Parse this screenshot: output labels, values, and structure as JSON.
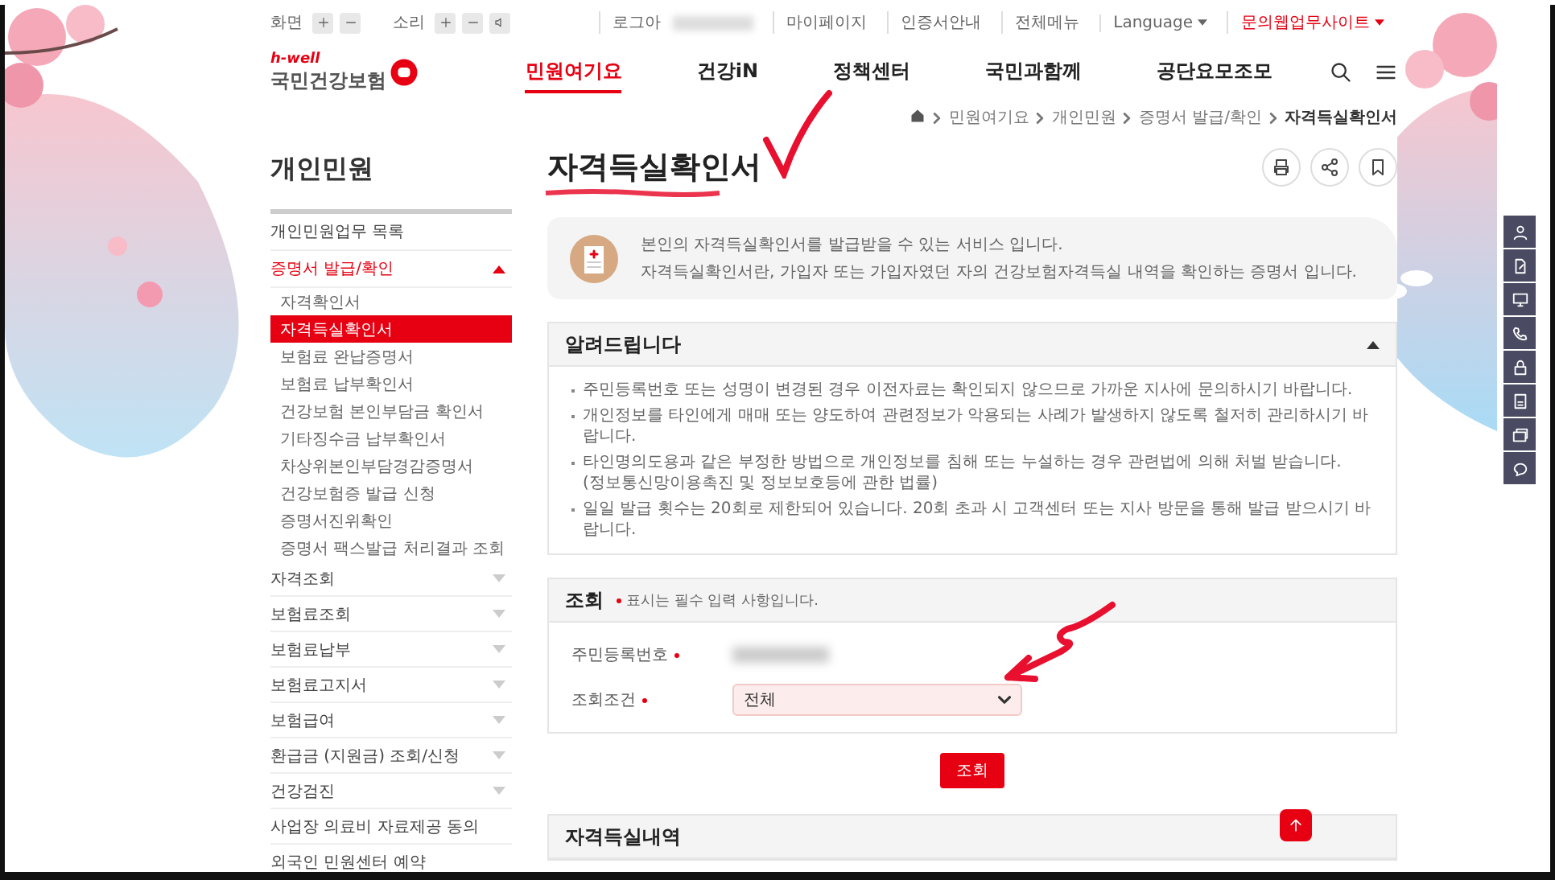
{
  "toolbar": {
    "screen_label": "화면",
    "sound_label": "소리"
  },
  "utility_links": [
    {
      "label": "로그아",
      "kind": "login"
    },
    {
      "label": "마이페이지",
      "kind": "link"
    },
    {
      "label": "인증서안내",
      "kind": "link"
    },
    {
      "label": "전체메뉴",
      "kind": "link"
    },
    {
      "label": "Language",
      "kind": "dropdown"
    },
    {
      "label": "문의웹업무사이트",
      "kind": "highlight"
    }
  ],
  "logo": {
    "tagline": "h-well",
    "name": "국민건강보험"
  },
  "nav": [
    {
      "label": "민원여기요",
      "selected": true
    },
    {
      "label": "건강iN",
      "selected": false
    },
    {
      "label": "정책센터",
      "selected": false
    },
    {
      "label": "국민과함께",
      "selected": false
    },
    {
      "label": "공단요모조모",
      "selected": false
    }
  ],
  "breadcrumb": [
    "민원여기요",
    "개인민원",
    "증명서 발급/확인",
    "자격득실확인서"
  ],
  "sidebar": {
    "title": "개인민원",
    "items": [
      {
        "label": "개인민원업무 목록",
        "kind": "link",
        "selected": false
      },
      {
        "label": "증명서 발급/확인",
        "kind": "group",
        "selected": true,
        "expanded": true,
        "children": [
          {
            "label": "자격확인서",
            "selected": false
          },
          {
            "label": "자격득실확인서",
            "selected": true
          },
          {
            "label": "보험료 완납증명서",
            "selected": false
          },
          {
            "label": "보험료 납부확인서",
            "selected": false
          },
          {
            "label": "건강보험 본인부담금 확인서",
            "selected": false
          },
          {
            "label": "기타징수금 납부확인서",
            "selected": false
          },
          {
            "label": "차상위본인부담경감증명서",
            "selected": false
          },
          {
            "label": "건강보험증 발급 신청",
            "selected": false
          },
          {
            "label": "증명서진위확인",
            "selected": false
          },
          {
            "label": "증명서 팩스발급 처리결과 조회",
            "selected": false
          }
        ]
      },
      {
        "label": "자격조회",
        "kind": "group",
        "selected": false,
        "expanded": false
      },
      {
        "label": "보험료조회",
        "kind": "group",
        "selected": false,
        "expanded": false
      },
      {
        "label": "보험료납부",
        "kind": "group",
        "selected": false,
        "expanded": false
      },
      {
        "label": "보험료고지서",
        "kind": "group",
        "selected": false,
        "expanded": false
      },
      {
        "label": "보험급여",
        "kind": "group",
        "selected": false,
        "expanded": false
      },
      {
        "label": "환급금 (지원금) 조회/신청",
        "kind": "group",
        "selected": false,
        "expanded": false
      },
      {
        "label": "건강검진",
        "kind": "group",
        "selected": false,
        "expanded": false
      },
      {
        "label": "사업장 의료비 자료제공 동의",
        "kind": "link",
        "selected": false
      },
      {
        "label": "외국인 민원센터 예약",
        "kind": "link",
        "selected": false
      }
    ]
  },
  "page_title": "자격득실확인서",
  "intro": [
    "본인의 자격득실확인서를 발급받을 수 있는 서비스 입니다.",
    "자격득실확인서란, 가입자 또는 가입자였던 자의 건강보험자격득실 내역을 확인하는 증명서 입니다."
  ],
  "notice": {
    "title": "알려드립니다",
    "expanded": true,
    "items": [
      {
        "text": "주민등록번호 또는 성명이 변경된 경우 이전자료는 확인되지 않으므로 가까운 지사에 문의하시기 바랍니다."
      },
      {
        "text": "개인정보를 타인에게 매매 또는 양도하여 관련정보가 악용되는 사례가 발생하지 않도록 철저히 관리하시기 바랍니다."
      },
      {
        "text": "타인명의도용과 같은 부정한 방법으로 개인정보를 침해 또는 누설하는 경우 관련법에 의해 처벌 받습니다.",
        "note": "(정보통신망이용촉진 및 정보보호등에 관한 법률)"
      },
      {
        "text": "일일 발급 횟수는 20회로 제한되어 있습니다. 20회 초과 시 고객센터 또는 지사 방문을 통해 발급 받으시기 바랍니다."
      }
    ]
  },
  "query": {
    "title": "조회",
    "required_hint": "표시는 필수 입력 사항입니다.",
    "fields": [
      {
        "label": "주민등록번호",
        "required": true,
        "kind": "blurred"
      },
      {
        "label": "조회조건",
        "required": true,
        "kind": "select",
        "value": "전체"
      }
    ],
    "submit": "조회"
  },
  "results": {
    "title": "자격득실내역"
  }
}
